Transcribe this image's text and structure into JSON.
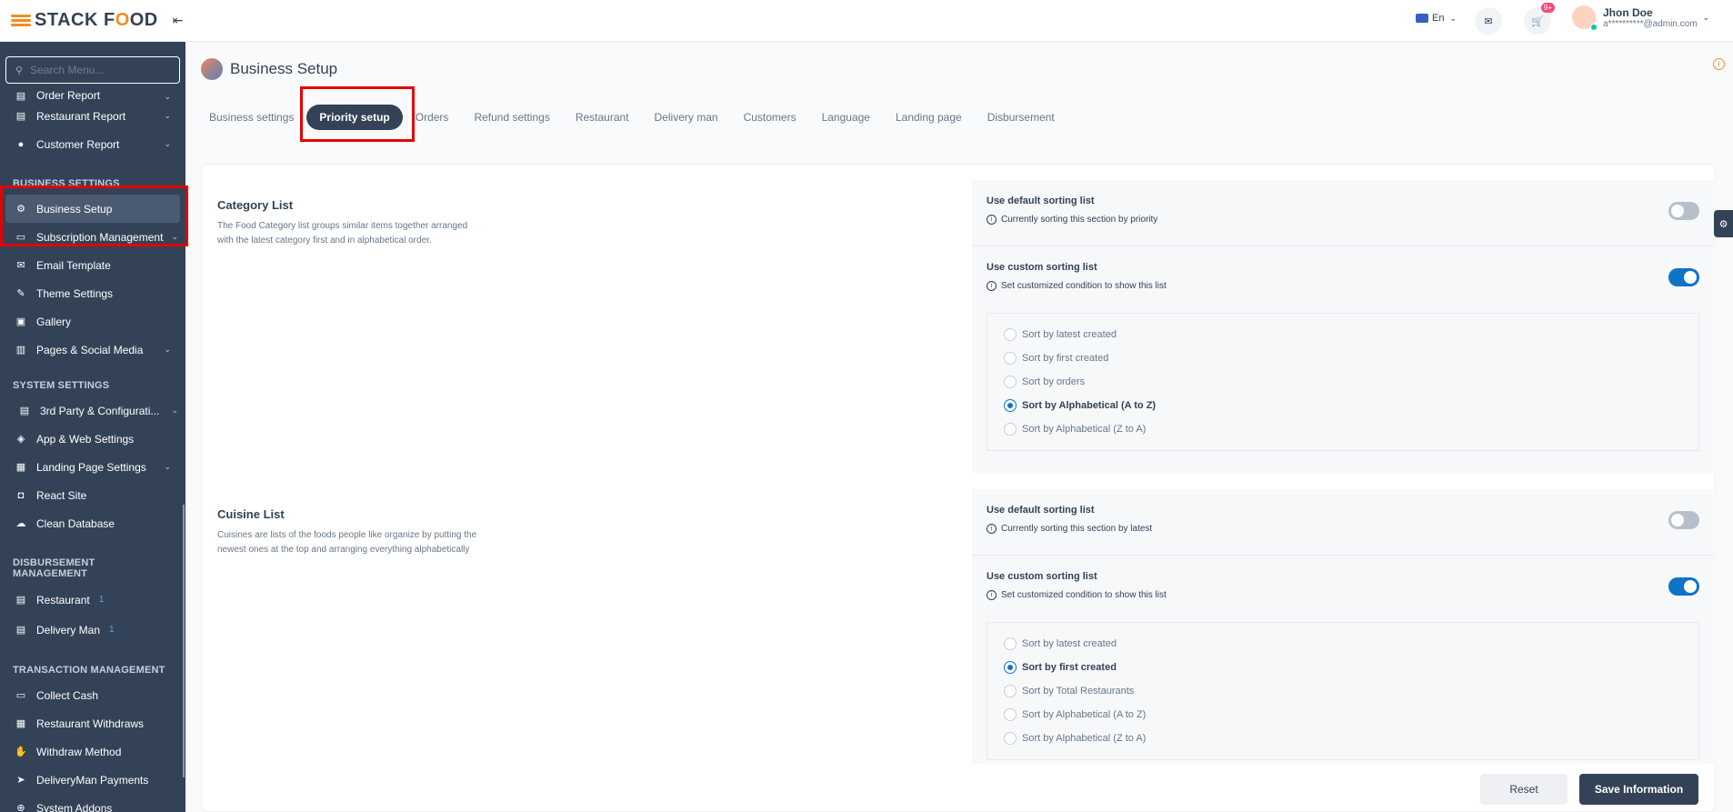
{
  "brand": {
    "logo_text_a": "STACK F",
    "logo_text_o": "O",
    "logo_text_b": "OD"
  },
  "sidebar": {
    "search_placeholder": "Search Menu...",
    "items_top": [
      {
        "label": "Order Report",
        "icon": "report-icon"
      },
      {
        "label": "Restaurant Report",
        "icon": "report-icon"
      },
      {
        "label": "Customer Report",
        "icon": "customer-icon"
      }
    ],
    "business_settings_title": "BUSINESS SETTINGS",
    "business_items": [
      {
        "label": "Business Setup",
        "icon": "gear-icon"
      },
      {
        "label": "Subscription Management",
        "icon": "subscription-icon"
      },
      {
        "label": "Email Template",
        "icon": "email-icon"
      },
      {
        "label": "Theme Settings",
        "icon": "brush-icon"
      },
      {
        "label": "Gallery",
        "icon": "gallery-icon"
      },
      {
        "label": "Pages & Social Media",
        "icon": "pages-icon"
      }
    ],
    "system_settings_title": "SYSTEM SETTINGS",
    "system_items": [
      {
        "label": "3rd Party & Configurati...",
        "icon": "config-icon"
      },
      {
        "label": "App & Web Settings",
        "icon": "android-icon"
      },
      {
        "label": "Landing Page Settings",
        "icon": "landing-icon"
      },
      {
        "label": "React Site",
        "icon": "react-icon"
      },
      {
        "label": "Clean Database",
        "icon": "cloud-icon"
      }
    ],
    "disbursement_title": "DISBURSEMENT MANAGEMENT",
    "disbursement_items": [
      {
        "label": "Restaurant",
        "icon": "restaurant-icon",
        "badge": "1"
      },
      {
        "label": "Delivery Man",
        "icon": "delivery-icon",
        "badge": "1"
      }
    ],
    "transaction_title": "TRANSACTION MANAGEMENT",
    "transaction_items": [
      {
        "label": "Collect Cash",
        "icon": "cash-icon"
      },
      {
        "label": "Restaurant Withdraws",
        "icon": "withdraw-icon"
      },
      {
        "label": "Withdraw Method",
        "icon": "method-icon"
      },
      {
        "label": "DeliveryMan Payments",
        "icon": "send-icon"
      },
      {
        "label": "System Addons",
        "icon": "addon-icon"
      }
    ]
  },
  "topbar": {
    "language": "En",
    "cart_count": "9+",
    "user_name": "Jhon Doe",
    "user_email": "a**********@admin.com"
  },
  "page": {
    "title": "Business Setup",
    "tabs": [
      "Business settings",
      "Priority setup",
      "Orders",
      "Refund settings",
      "Restaurant",
      "Delivery man",
      "Customers",
      "Language",
      "Landing page",
      "Disbursement"
    ]
  },
  "category": {
    "title": "Category List",
    "description": "The Food Category list groups similar items together arranged with the latest category first and in alphabetical order.",
    "default_label": "Use default sorting list",
    "default_sub": "Currently sorting this section by priority",
    "default_on": false,
    "custom_label": "Use custom sorting list",
    "custom_sub": "Set customized condition to show this list",
    "custom_on": true,
    "options": [
      "Sort by latest created",
      "Sort by first created",
      "Sort by orders",
      "Sort by Alphabetical (A to Z)",
      "Sort by Alphabetical (Z to A)"
    ],
    "selected_index": 3
  },
  "cuisine": {
    "title": "Cuisine List",
    "description": "Cuisines are lists of the foods people like organize by putting the newest ones at the top and arranging everything alphabetically",
    "default_label": "Use default sorting list",
    "default_sub": "Currently sorting this section by latest",
    "default_on": false,
    "custom_label": "Use custom sorting list",
    "custom_sub": "Set customized condition to show this list",
    "custom_on": true,
    "options": [
      "Sort by latest created",
      "Sort by first created",
      "Sort by Total Restaurants",
      "Sort by Alphabetical (A to Z)",
      "Sort by Alphabetical (Z to A)"
    ],
    "selected_index": 1
  },
  "actions": {
    "reset": "Reset",
    "save": "Save Information"
  },
  "colors": {
    "sidebar": "#334257",
    "accent": "#0f73c7",
    "brand_orange": "#f28e22",
    "highlight": "#e40000"
  }
}
